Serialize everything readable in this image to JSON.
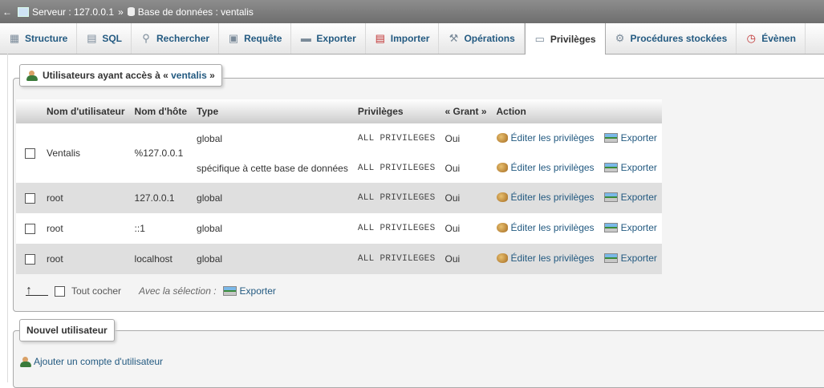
{
  "breadcrumb": {
    "server_label": "Serveur : 127.0.0.1",
    "separator": "»",
    "database_label": "Base de données : ventalis"
  },
  "tabs": [
    {
      "label": "Structure",
      "icon": "structure-icon"
    },
    {
      "label": "SQL",
      "icon": "sql-icon"
    },
    {
      "label": "Rechercher",
      "icon": "search-icon"
    },
    {
      "label": "Requête",
      "icon": "query-icon"
    },
    {
      "label": "Exporter",
      "icon": "export-icon"
    },
    {
      "label": "Importer",
      "icon": "import-icon"
    },
    {
      "label": "Opérations",
      "icon": "wrench-icon"
    },
    {
      "label": "Privilèges",
      "icon": "privileges-icon",
      "active": true
    },
    {
      "label": "Procédures stockées",
      "icon": "routines-icon"
    },
    {
      "label": "Évènen",
      "icon": "events-icon"
    }
  ],
  "users_box": {
    "legend_prefix": "Utilisateurs ayant accès à « ",
    "legend_db": "ventalis",
    "legend_suffix": " »",
    "columns": [
      "",
      "Nom d'utilisateur",
      "Nom d'hôte",
      "Type",
      "Privilèges",
      "« Grant »",
      "Action",
      ""
    ],
    "rows": [
      {
        "user": "Ventalis",
        "host": "%127.0.0.1",
        "type": "global",
        "privileges": "ALL PRIVILEGES",
        "grant": "Oui",
        "edit": "Éditer les privilèges",
        "export": "Exporter"
      },
      {
        "type": "spécifique à cette base de données",
        "privileges": "ALL PRIVILEGES",
        "grant": "Oui",
        "edit": "Éditer les privilèges",
        "export": "Exporter"
      },
      {
        "user": "root",
        "host": "127.0.0.1",
        "type": "global",
        "privileges": "ALL PRIVILEGES",
        "grant": "Oui",
        "edit": "Éditer les privilèges",
        "export": "Exporter"
      },
      {
        "user": "root",
        "host": "::1",
        "type": "global",
        "privileges": "ALL PRIVILEGES",
        "grant": "Oui",
        "edit": "Éditer les privilèges",
        "export": "Exporter"
      },
      {
        "user": "root",
        "host": "localhost",
        "type": "global",
        "privileges": "ALL PRIVILEGES",
        "grant": "Oui",
        "edit": "Éditer les privilèges",
        "export": "Exporter"
      }
    ],
    "check_all": "Tout cocher",
    "with_selected": "Avec la sélection :",
    "bulk_export": "Exporter"
  },
  "new_user_box": {
    "legend": "Nouvel utilisateur",
    "add_link": "Ajouter un compte d'utilisateur"
  },
  "colors": {
    "link": "#235a81",
    "topbar": "#7a7a7a",
    "row_alt": "#dfdfdf"
  }
}
